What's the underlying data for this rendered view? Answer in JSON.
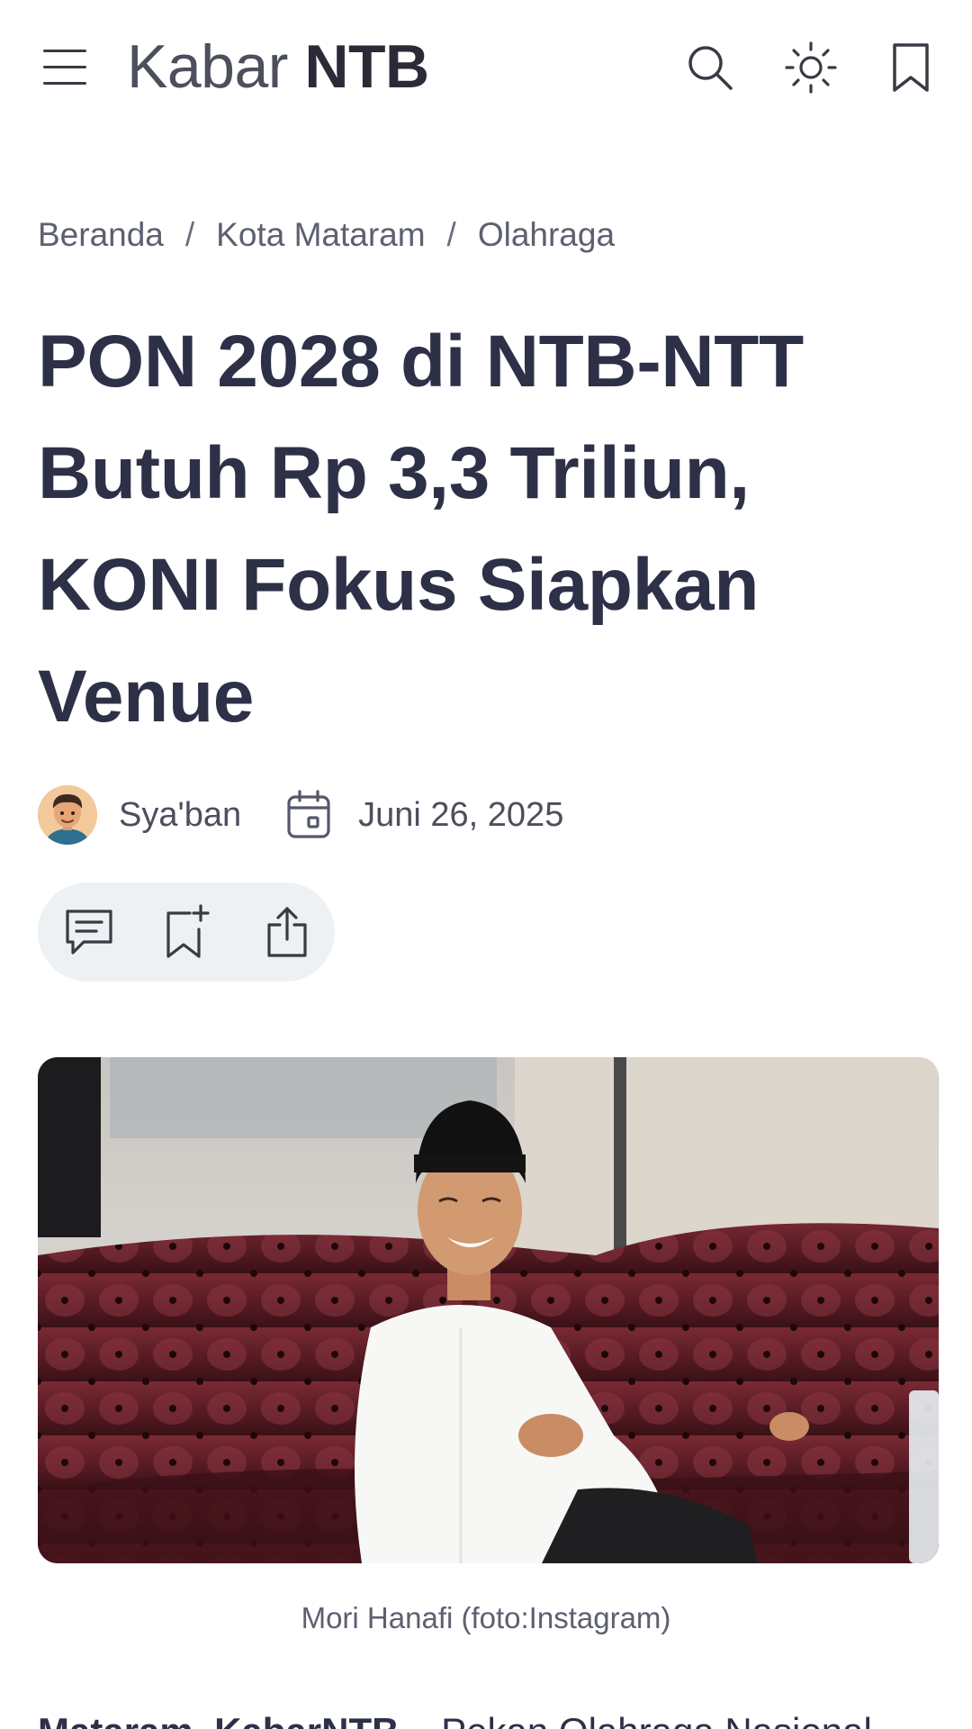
{
  "header": {
    "logo_light": "Kabar",
    "logo_bold": "NTB",
    "icons": [
      "menu-icon",
      "search-icon",
      "sun-icon",
      "bookmark-icon"
    ]
  },
  "breadcrumb": {
    "items": [
      "Beranda",
      "Kota Mataram",
      "Olahraga"
    ],
    "separator": "/"
  },
  "article": {
    "title": "PON 2028 di NTB-NTT Butuh Rp 3,3 Triliun, KONI Fokus Siapkan Venue",
    "author": "Sya'ban",
    "date": "Juni 26, 2025",
    "actions": [
      "comment-icon",
      "bookmark-add-icon",
      "share-icon"
    ],
    "image_caption": "Mori Hanafi (foto:Instagram)",
    "lead_bold": "Mataram, KabarNTB",
    "lead_text": " – Pekan Olahraga Nasional"
  },
  "colors": {
    "text_dark": "#2d3047",
    "text_muted": "#5d6070",
    "pill_bg": "#eef1f3"
  }
}
